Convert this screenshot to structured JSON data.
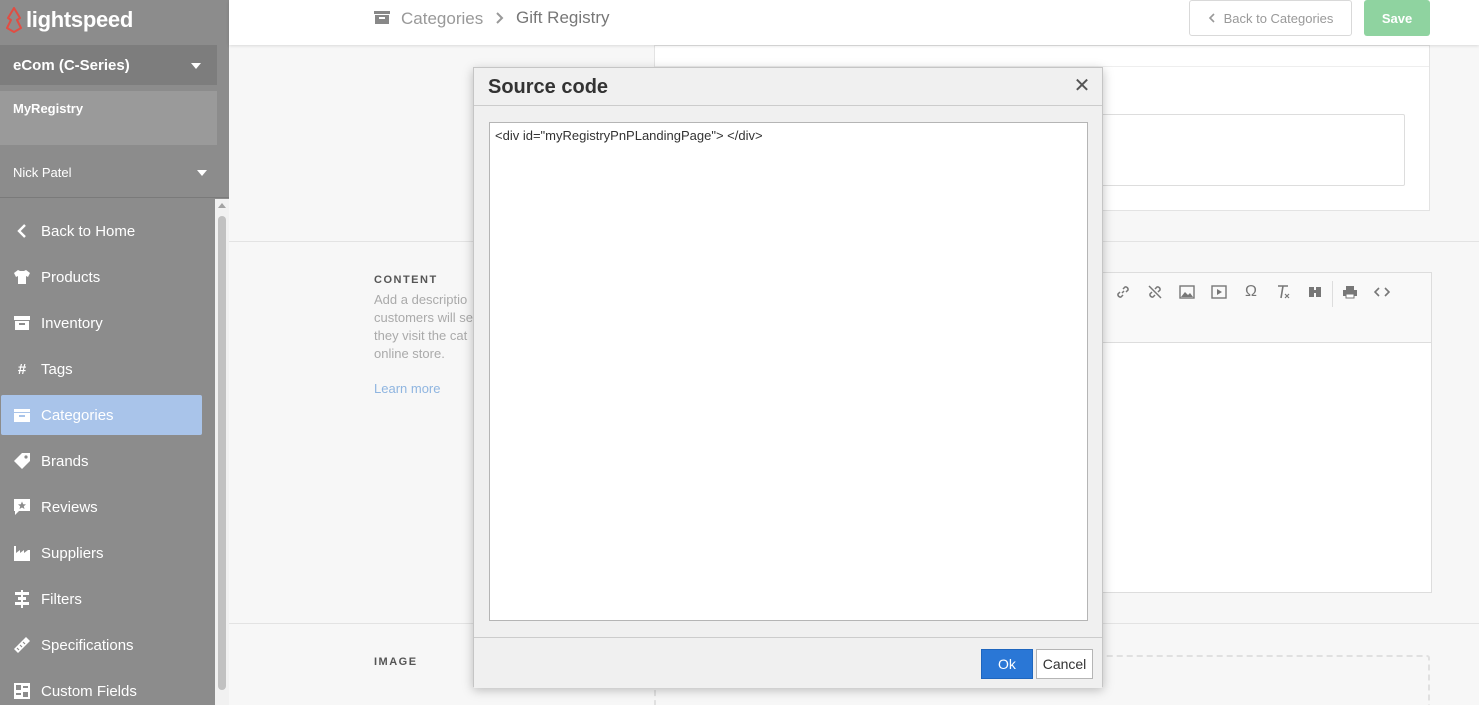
{
  "brand": {
    "logo_text": "lightspeed",
    "accent": "#e14d43"
  },
  "sidebar": {
    "store_name": "eCom (C-Series)",
    "account_name": "MyRegistry",
    "user_name": "Nick Patel",
    "items": [
      {
        "label": "Back to Home",
        "icon": "chevron-left-icon"
      },
      {
        "label": "Products",
        "icon": "shirt-icon"
      },
      {
        "label": "Inventory",
        "icon": "box-icon"
      },
      {
        "label": "Tags",
        "icon": "hash-icon"
      },
      {
        "label": "Categories",
        "icon": "folder-icon",
        "active": true
      },
      {
        "label": "Brands",
        "icon": "tag-icon"
      },
      {
        "label": "Reviews",
        "icon": "review-icon"
      },
      {
        "label": "Suppliers",
        "icon": "factory-icon"
      },
      {
        "label": "Filters",
        "icon": "filter-icon"
      },
      {
        "label": "Specifications",
        "icon": "ruler-icon"
      },
      {
        "label": "Custom Fields",
        "icon": "fields-icon"
      }
    ]
  },
  "topbar": {
    "breadcrumb_parent": "Categories",
    "breadcrumb_sep": ">",
    "breadcrumb_current": "Gift Registry",
    "back_label": "Back to Categories",
    "save_label": "Save"
  },
  "content_section": {
    "label": "CONTENT",
    "help_lines": [
      "Add a descriptio",
      "customers will se",
      "they visit the cat",
      "online store."
    ],
    "learn_more": "Learn more"
  },
  "image_section": {
    "label": "IMAGE"
  },
  "modal": {
    "title": "Source code",
    "close_glyph": "✕",
    "code": "<div id=\"myRegistryPnPLandingPage\"> </div>",
    "ok_label": "Ok",
    "cancel_label": "Cancel"
  }
}
